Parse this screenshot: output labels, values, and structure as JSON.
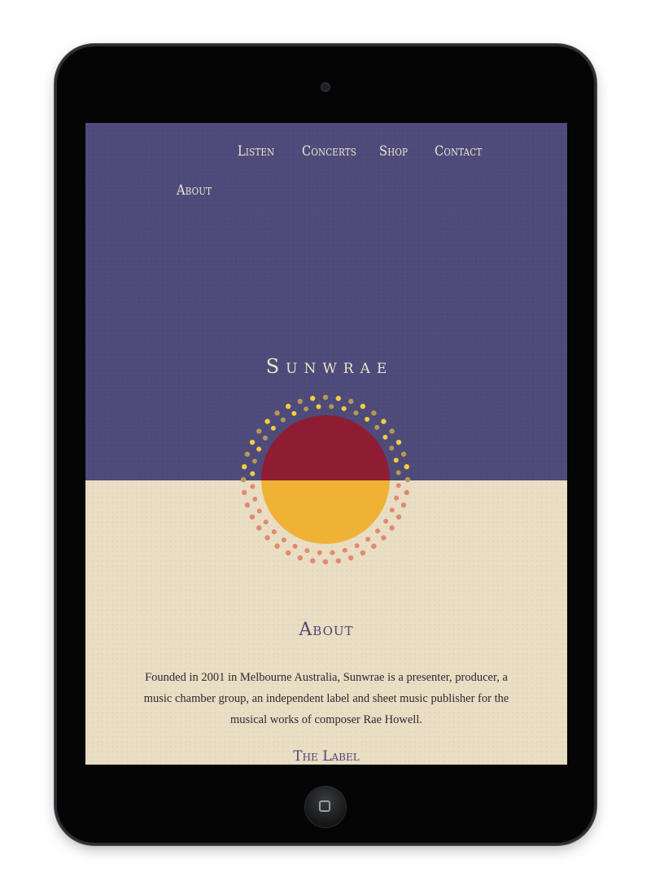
{
  "nav": {
    "items": [
      {
        "label": "Listen"
      },
      {
        "label": "Concerts"
      },
      {
        "label": "Shop"
      },
      {
        "label": "Contact"
      },
      {
        "label": "About"
      }
    ]
  },
  "hero": {
    "brand": "Sunwrae"
  },
  "about": {
    "heading": "About",
    "body": "Founded in 2001 in Melbourne Australia, Sunwrae is a presenter, producer, a music chamber group, an independent label and sheet music publisher for the musical works of composer Rae Howell.",
    "next_heading": "The Label"
  },
  "colors": {
    "hero_bg": "#4e4a7a",
    "paper_bg": "#e9ddc3",
    "sun_red": "#8e1d33",
    "sun_gold": "#f0b234",
    "dots_yellow": "#f2cd3d",
    "dots_olive": "#b29a56",
    "dots_coral": "#df8b6f",
    "heading": "#4b4675"
  },
  "icons": {
    "logo": "sunwrae-sun-logo-icon",
    "camera": "front-camera-icon",
    "home": "home-button-icon"
  }
}
